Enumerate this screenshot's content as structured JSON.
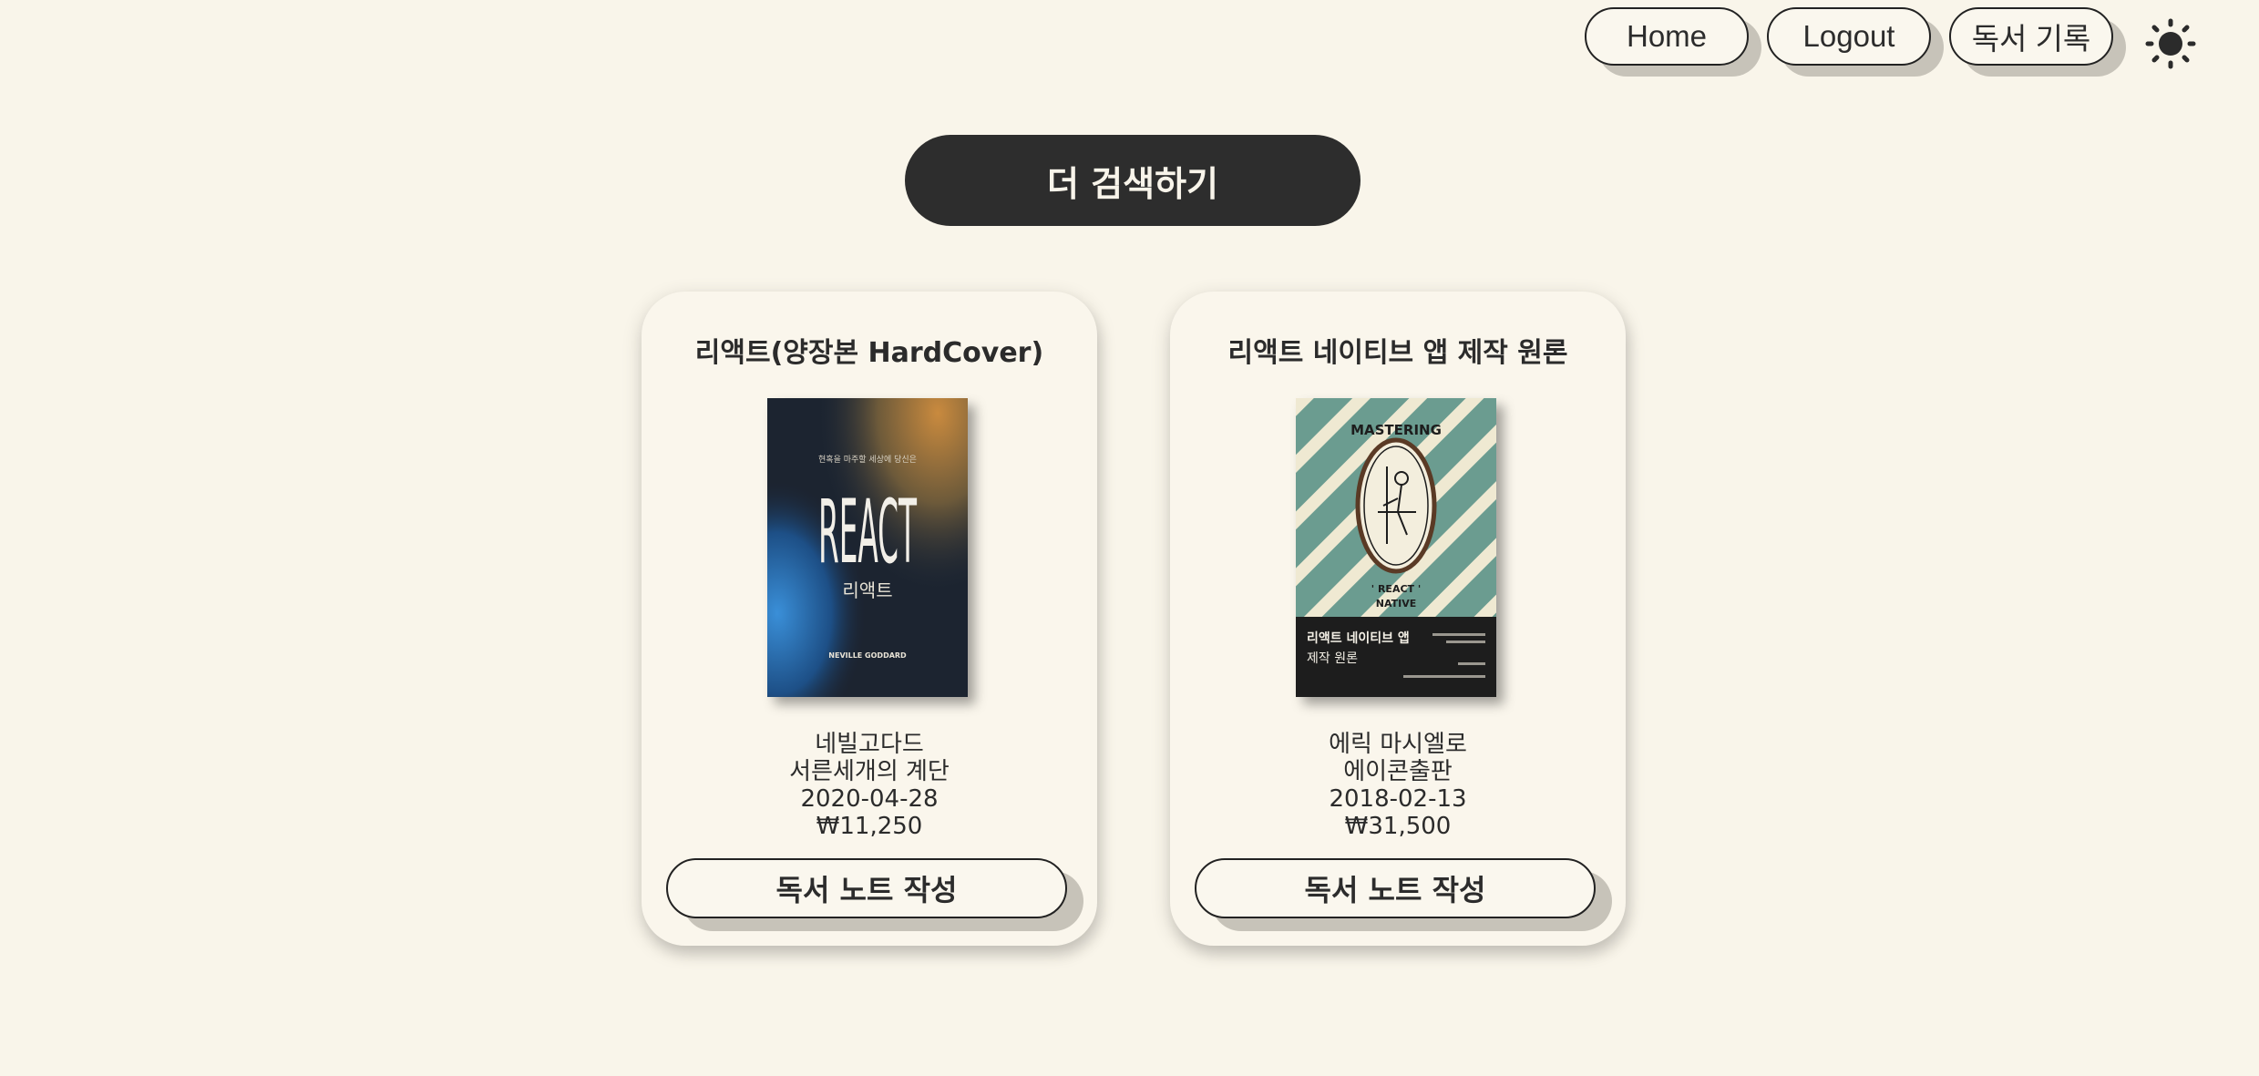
{
  "nav": {
    "home_label": "Home",
    "logout_label": "Logout",
    "records_label": "독서 기록",
    "theme_icon": "sun-icon"
  },
  "search_more_label": "더 검색하기",
  "books": [
    {
      "title": "리액트(양장본 HardCover)",
      "author": "네빌고다드",
      "publisher": "서른세개의 계단",
      "date": "2020-04-28",
      "price": "₩11,250",
      "note_button": "독서 노트 작성",
      "cover": {
        "subtitle": "현혹을 마주할 세상에 당신은",
        "main": "REACT",
        "korean": "리액트",
        "author": "NEVILLE GODDARD"
      }
    },
    {
      "title": "리액트 네이티브 앱 제작 원론",
      "author": "에릭 마시엘로",
      "publisher": "에이콘출판",
      "date": "2018-02-13",
      "price": "₩31,500",
      "note_button": "독서 노트 작성",
      "cover": {
        "top_text": "MASTERING",
        "mid_text": "' REACT '",
        "mid_text2": "NATIVE",
        "korean_title_1": "리액트 네이티브 앱",
        "korean_title_2": "제작 원론"
      }
    }
  ],
  "colors": {
    "background": "#f9f5ea",
    "dark_button": "#2d2d2d",
    "button_shadow": "#c7c3b9"
  }
}
